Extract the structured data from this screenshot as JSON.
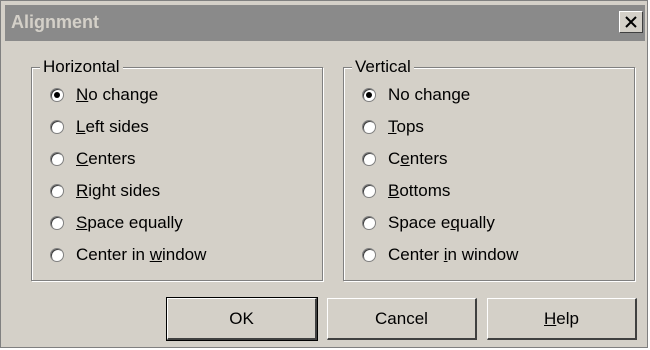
{
  "window": {
    "title": "Alignment",
    "close_icon": "close-icon"
  },
  "horizontal": {
    "label": "Horizontal",
    "options": [
      {
        "pre": "",
        "u": "N",
        "post": "o change",
        "selected": true
      },
      {
        "pre": "",
        "u": "L",
        "post": "eft sides",
        "selected": false
      },
      {
        "pre": "",
        "u": "C",
        "post": "enters",
        "selected": false
      },
      {
        "pre": "",
        "u": "R",
        "post": "ight sides",
        "selected": false
      },
      {
        "pre": "",
        "u": "S",
        "post": "pace equally",
        "selected": false
      },
      {
        "pre": "Center in ",
        "u": "w",
        "post": "indow",
        "selected": false
      }
    ]
  },
  "vertical": {
    "label": "Vertical",
    "options": [
      {
        "pre": "No change",
        "u": "",
        "post": "",
        "selected": true
      },
      {
        "pre": "",
        "u": "T",
        "post": "ops",
        "selected": false
      },
      {
        "pre": "C",
        "u": "e",
        "post": "nters",
        "selected": false
      },
      {
        "pre": "",
        "u": "B",
        "post": "ottoms",
        "selected": false
      },
      {
        "pre": "Space e",
        "u": "q",
        "post": "ually",
        "selected": false
      },
      {
        "pre": "Center ",
        "u": "i",
        "post": "n window",
        "selected": false
      }
    ]
  },
  "buttons": {
    "ok": "OK",
    "cancel": "Cancel",
    "help_u": "H",
    "help_rest": "elp"
  }
}
